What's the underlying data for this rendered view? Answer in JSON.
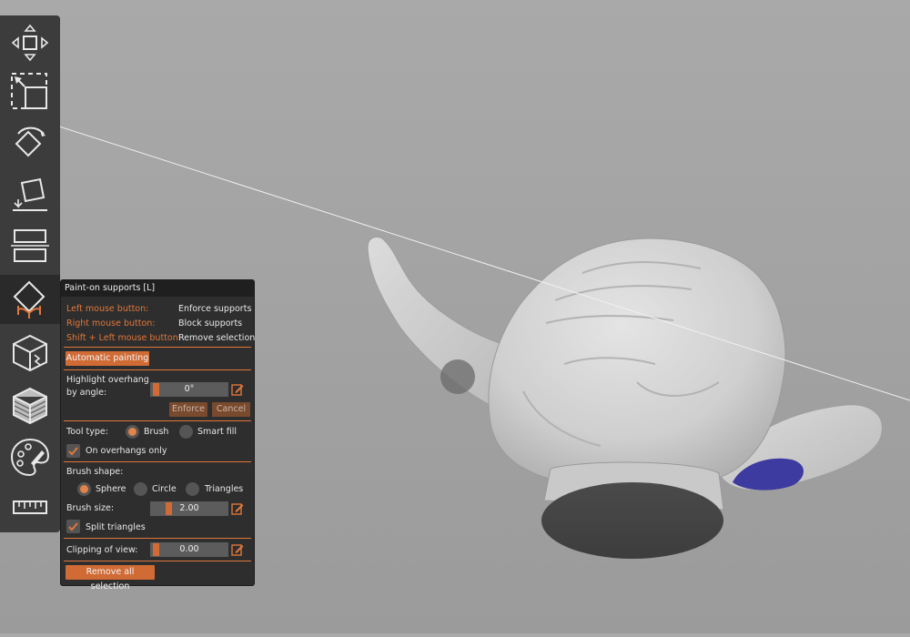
{
  "panel": {
    "title": "Paint-on supports [L]",
    "hints": [
      {
        "action": "Left mouse button:",
        "result": "Enforce supports"
      },
      {
        "action": "Right mouse button:",
        "result": "Block supports"
      },
      {
        "action": "Shift + Left mouse button:",
        "result": "Remove selection"
      }
    ],
    "automatic_painting": "Automatic painting",
    "highlight_label_1": "Highlight overhang",
    "highlight_label_2": "by angle:",
    "highlight_value": "0°",
    "enforce": "Enforce",
    "cancel": "Cancel",
    "tool_type_label": "Tool type:",
    "tool_brush": "Brush",
    "tool_smart_fill": "Smart fill",
    "tool_selected": "Brush",
    "on_overhangs_only": "On overhangs only",
    "on_overhangs_checked": true,
    "brush_shape_label": "Brush shape:",
    "shape_sphere": "Sphere",
    "shape_circle": "Circle",
    "shape_triangles": "Triangles",
    "shape_selected": "Sphere",
    "brush_size_label": "Brush size:",
    "brush_size_value": "2.00",
    "split_triangles": "Split triangles",
    "split_triangles_checked": true,
    "clipping_label": "Clipping of view:",
    "clipping_value": "0.00",
    "remove_all": "Remove all selection"
  },
  "toolbar": {
    "tools": [
      "move-icon",
      "scale-icon",
      "rotate-icon",
      "place-on-face-icon",
      "cut-icon",
      "paint-supports-icon",
      "seam-painting-icon",
      "variable-layer-height-icon",
      "multimaterial-painting-icon",
      "measure-icon"
    ],
    "active_tool": "paint-supports-icon"
  },
  "colors": {
    "accent": "#e0773a",
    "enforcer_paint": "#3d3aa0",
    "panel_bg": "#2e2e2e",
    "toolbar_bg": "#3c3c3c",
    "viewport_bg": "#a3a3a3"
  }
}
